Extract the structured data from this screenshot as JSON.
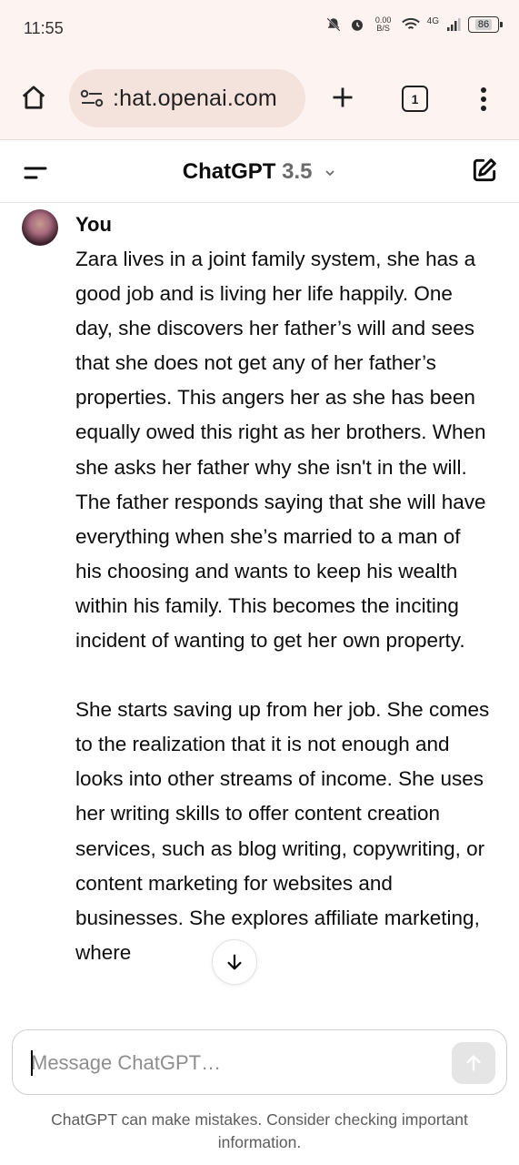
{
  "status_bar": {
    "time": "11:55",
    "net_speed_value": "0.00",
    "net_speed_unit": "B/S",
    "network": "4G",
    "battery": "86"
  },
  "browser": {
    "url": ":hat.openai.com",
    "tab_count": "1"
  },
  "app_header": {
    "title": "ChatGPT",
    "version": "3.5"
  },
  "message": {
    "author": "You",
    "paragraphs": [
      "Zara lives in a joint family system, she has a good job and is living her life happily. One day, she discovers her father’s will and sees that she does not get any of her father’s properties. This angers her as she has been equally owed this right as her brothers. When she asks her father why she isn't in the will. The father responds saying that she will have everything when she’s married to a man of his choosing and wants to keep his wealth within his family. This becomes the inciting incident of wanting to get her own property.",
      "She starts saving up from her job. She comes to the realization that it is not enough and looks into other streams of income. She uses her writing skills to offer content creation services, such as blog writing, copywriting, or content marketing for websites and businesses. She explores affiliate marketing, where"
    ]
  },
  "composer": {
    "placeholder": "Message ChatGPT…"
  },
  "disclaimer": "ChatGPT can make mistakes. Consider checking important information.",
  "colors": {
    "browser_chrome": "#fdf3f0",
    "url_pill": "#f4e2dc",
    "text": "#0d0d0d",
    "muted": "#6b6b6b"
  }
}
